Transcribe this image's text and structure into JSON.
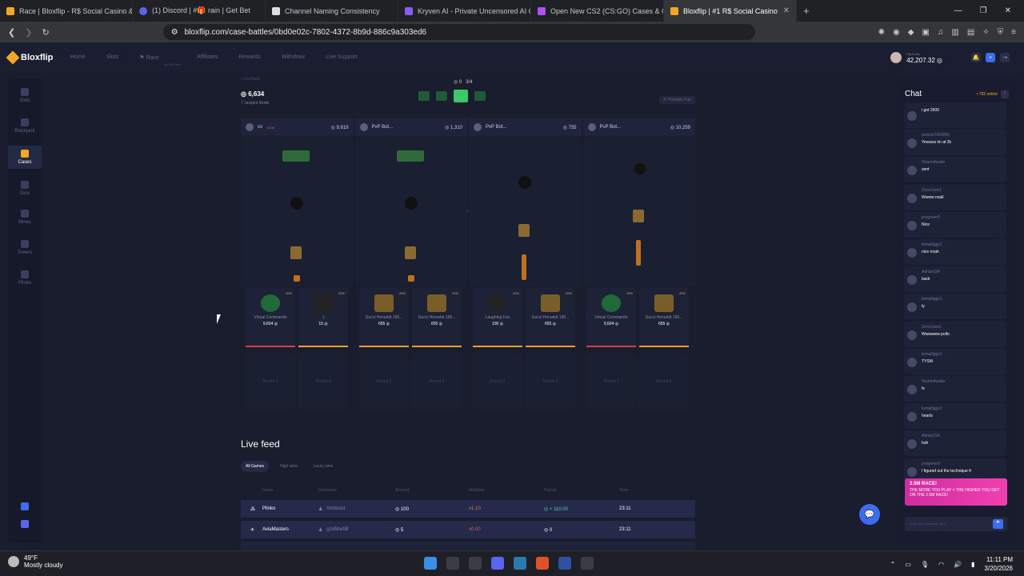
{
  "browser": {
    "tabs": [
      "Race | Bloxflip - R$ Social Casino & A",
      "(1) Discord | #🎁 rain | Get Bet",
      "Channel Naming Consistency",
      "Kryven AI - Private Uncensored AI Ch",
      "Open New CS2 (CS:GO) Cases & Get",
      "Bloxflip | #1 R$ Social Casino"
    ],
    "url": "bloxflip.com/case-battles/0bd0e02c-7802-4372-8b9d-886c9a303ed6"
  },
  "site": {
    "logo": "Bloxflip",
    "nav": [
      "Home",
      "Slots",
      "Race",
      "Affiliates",
      "Rewards",
      "Withdraw",
      "Live Support"
    ],
    "race_sub": "2d 18h 58m",
    "balance_label": "FlipCoins",
    "balance": "42,207.32"
  },
  "sidebar": [
    "Slots",
    "Blackjack",
    "Cases",
    "Dice",
    "Mines",
    "Towers",
    "Plinko"
  ],
  "battle": {
    "back": "< Go Back",
    "total": "6,634",
    "mode": "Jackpot Mode",
    "round_count": "0",
    "round_of": "3/4",
    "fair": "Provably Fair",
    "players": [
      {
        "name": "cv",
        "level": "43.85",
        "value": "9,619"
      },
      {
        "name": "PvP Bot...",
        "value": "1,310"
      },
      {
        "name": "PvP Bot...",
        "value": "755"
      },
      {
        "name": "PvP Bot...",
        "value": "10,259"
      }
    ],
    "vs": "vs",
    "drops": [
      {
        "pct": "10%",
        "name": "Virtual Commando",
        "price": "9,604"
      },
      {
        "pct": "20%",
        "name": ":)",
        "price": "15"
      },
      {
        "pct": "20%",
        "name": "Gucci Horsebit 195...",
        "price": "655"
      },
      {
        "pct": "20%",
        "name": "Gucci Horsebit 195...",
        "price": "655"
      },
      {
        "pct": "20%",
        "name": "Laughing Fun",
        "price": "100"
      },
      {
        "pct": "20%",
        "name": "Gucci Horsebit 195...",
        "price": "655"
      },
      {
        "pct": "10%",
        "name": "Virtual Commando",
        "price": "9,604"
      },
      {
        "pct": "20%",
        "name": "Gucci Horsebit 195...",
        "price": "655"
      }
    ],
    "rounds": [
      "Round 3",
      "Round 4",
      "Round 3",
      "Round 4",
      "Round 3",
      "Round 4",
      "Round 3",
      "Round 4"
    ]
  },
  "feed": {
    "title": "Live feed",
    "tabs": [
      "All Games",
      "High wins",
      "Lucky wins"
    ],
    "headers": [
      "Game",
      "Username",
      "Amount",
      "Multiplier",
      "Payout",
      "Time"
    ],
    "rows": [
      {
        "game": "Plinko",
        "user": "0xWesst",
        "amount": "100",
        "mult": "x1.10",
        "payout": "+ 110.00",
        "time": "23:11"
      },
      {
        "game": "AviaMasters",
        "user": "g16MartiB",
        "amount": "5",
        "mult": "x0.00",
        "payout": "0",
        "time": "23:11"
      }
    ]
  },
  "chat": {
    "title": "Chat",
    "online": "782 online",
    "messages": [
      {
        "u": "",
        "t": "i got 2500"
      },
      {
        "u": "pollock7064865",
        "t": "Yesssss im at 2k"
      },
      {
        "u": "Hearts4wake",
        "t": "sent"
      },
      {
        "u": "Zorro1ww1",
        "t": "Wwww noall"
      },
      {
        "u": "progreen9",
        "t": "Nice"
      },
      {
        "u": "lwinalliggs1",
        "t": "nice noah"
      },
      {
        "u": "Adrian234",
        "t": "back"
      },
      {
        "u": "lwinalliggs1",
        "t": "ty"
      },
      {
        "u": "Zorro1ww1",
        "t": "Wwwwww pollo"
      },
      {
        "u": "lwinalliggs1",
        "t": "TYSM"
      },
      {
        "u": "Hearts4wake",
        "t": "fs"
      },
      {
        "u": "lwinalliggs1",
        "t": "hearts"
      },
      {
        "u": "Adrian234",
        "t": "huh"
      },
      {
        "u": "progreen9",
        "t": "I figured out the technique fr"
      }
    ],
    "race_title": "2.5M RACE!",
    "race_text": "THE MORE YOU PLAY = THE HIGHER YOU GET ON THE 2.5M RACE!",
    "input_placeholder": "Enter your message here..."
  },
  "taskbar": {
    "temp": "49°F",
    "weather": "Mostly cloudy",
    "time": "11:11 PM",
    "date": "3/20/2026"
  }
}
